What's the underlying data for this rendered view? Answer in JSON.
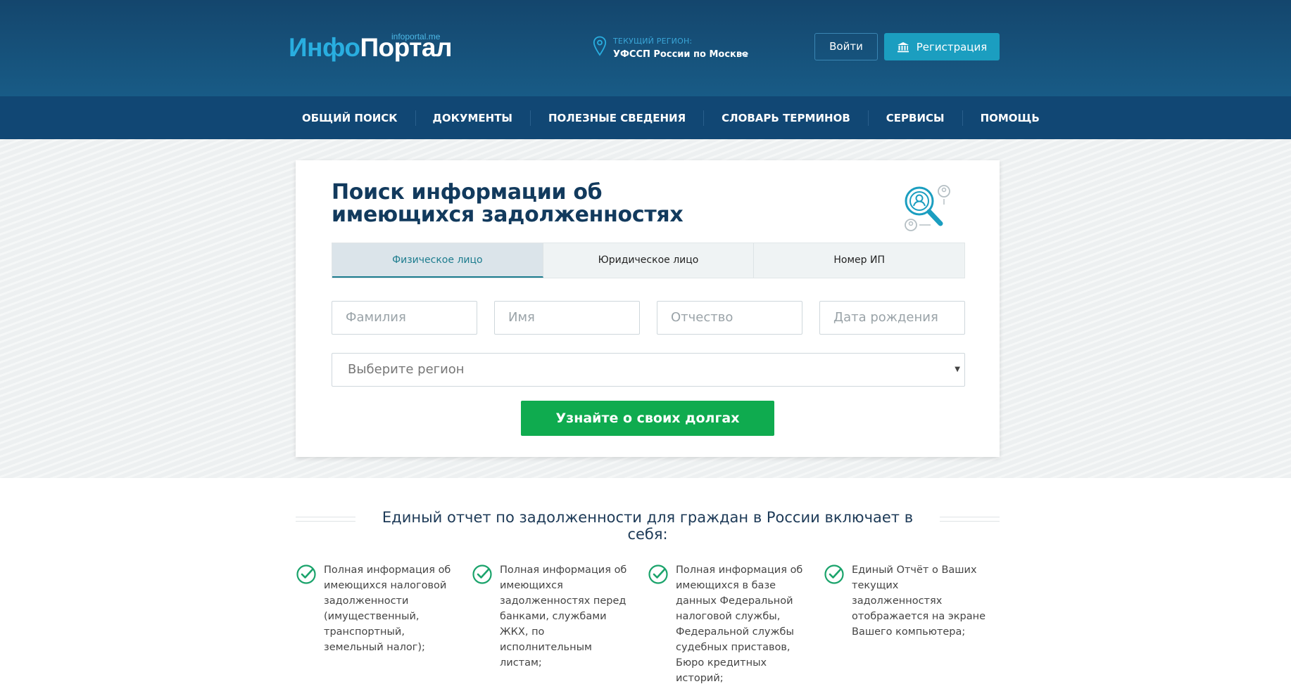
{
  "header": {
    "logo_part1": "Инфо",
    "logo_part2": "Портал",
    "logo_domain": "infoportal.me",
    "region_label": "Текущий регион:",
    "region_value": "УФССП России по Москве",
    "login_label": "Войти",
    "register_label": "Регистрация"
  },
  "nav": {
    "items": [
      "ОБЩИЙ ПОИСК",
      "ДОКУМЕНТЫ",
      "ПОЛЕЗНЫЕ СВЕДЕНИЯ",
      "СЛОВАРЬ ТЕРМИНОВ",
      "СЕРВИСЫ",
      "ПОМОЩЬ"
    ]
  },
  "search": {
    "title_line1": "Поиск информации об",
    "title_line2": "имеющихся задолженностях",
    "tabs": [
      "Физическое лицо",
      "Юридическое лицо",
      "Номер ИП"
    ],
    "active_tab": 0,
    "fields": {
      "surname_placeholder": "Фамилия",
      "name_placeholder": "Имя",
      "patronymic_placeholder": "Отчество",
      "birthdate_placeholder": "Дата рождения"
    },
    "region_select": "Выберите регион",
    "submit_label": "Узнайте о своих долгах"
  },
  "report": {
    "heading": "Единый отчет по задолженности для граждан в России включает в себя:",
    "items": [
      "Полная информация об имеющихся налоговой задолженности (имущественный, транспортный, земельный налог);",
      "Полная информация об имеющихся задолженностях перед банками, службами ЖКХ, по исполнительным листам;",
      "Полная информация об имеющихся в базе данных Федеральной налоговой службы, Федеральной службы судебных приставов, Бюро кредитных историй;",
      "Единый Отчёт о Ваших текущих задолженностях отображается на экране Вашего компьютера;"
    ]
  },
  "colors": {
    "header_bg": "#185b86",
    "nav_bg": "#114774",
    "accent_blue": "#29aee0",
    "register_btn": "#1b9ec0",
    "submit_btn": "#0fab4f",
    "check_green": "#1aa36b"
  }
}
